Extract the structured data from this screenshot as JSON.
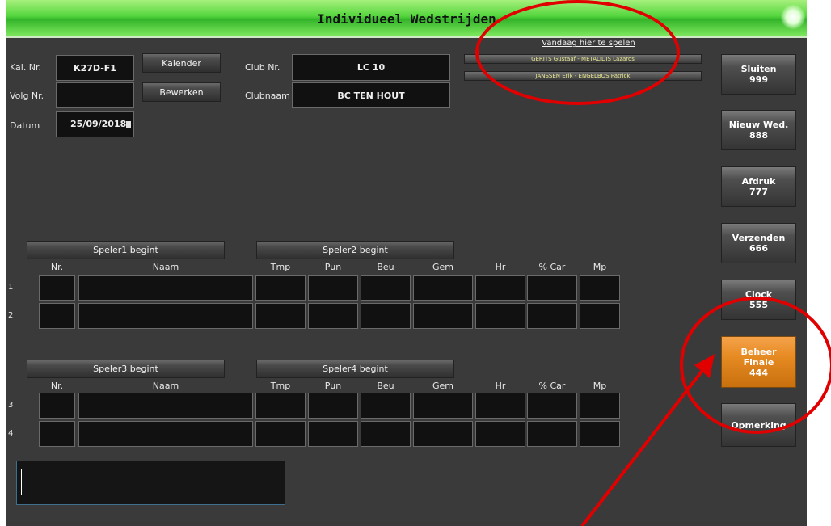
{
  "window": {
    "title": "Individueel Wedstrijden"
  },
  "header": {
    "today_label": "Vandaag hier te spelen",
    "today_matches": [
      "GERITS Gustaaf - METALIDIS Lazaros",
      "JANSSEN Erik - ENGELBOS Patrick"
    ]
  },
  "form": {
    "kal_nr_label": "Kal. Nr.",
    "kal_nr_value": "K27D-F1",
    "volg_nr_label": "Volg Nr.",
    "volg_nr_value": "",
    "datum_label": "Datum",
    "datum_value": "25/09/2018",
    "kalender_button": "Kalender",
    "bewerken_button": "Bewerken",
    "club_nr_label": "Club Nr.",
    "club_nr_value": "LC 10",
    "clubnaam_label": "Clubnaam",
    "clubnaam_value": "BC TEN HOUT"
  },
  "side_buttons": [
    {
      "label": "Sluiten",
      "code": "999"
    },
    {
      "label": "Nieuw Wed.",
      "code": "888"
    },
    {
      "label": "Afdruk",
      "code": "777"
    },
    {
      "label": "Verzenden",
      "code": "666"
    },
    {
      "label": "Clock",
      "code": "555"
    },
    {
      "label": "Beheer\nFinale",
      "code": "444"
    },
    {
      "label": "Opmerking",
      "code": ""
    }
  ],
  "grid1": {
    "start_buttons": [
      "Speler1 begint",
      "Speler2 begint"
    ],
    "columns": [
      "Nr.",
      "Naam",
      "Tmp",
      "Pun",
      "Beu",
      "Gem",
      "Hr",
      "% Car",
      "Mp"
    ],
    "rows": [
      "1",
      "2"
    ]
  },
  "grid2": {
    "start_buttons": [
      "Speler3 begint",
      "Speler4 begint"
    ],
    "columns": [
      "Nr.",
      "Naam",
      "Tmp",
      "Pun",
      "Beu",
      "Gem",
      "Hr",
      "% Car",
      "Mp"
    ],
    "rows": [
      "3",
      "4"
    ]
  },
  "colors": {
    "title_green": "#55d63e",
    "accent_orange": "#e68a22",
    "annotation_red": "#e00000"
  }
}
